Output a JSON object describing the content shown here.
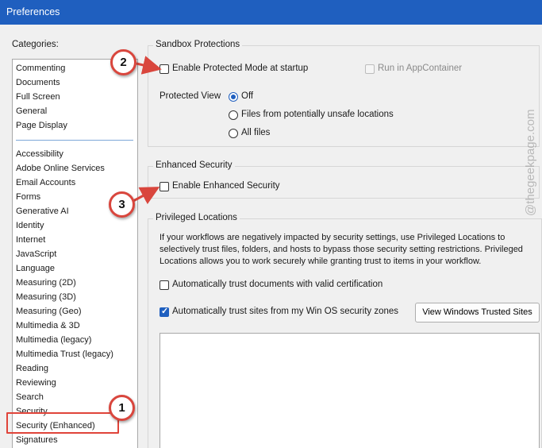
{
  "window": {
    "title": "Preferences"
  },
  "categories": {
    "label": "Categories:",
    "group1": [
      "Commenting",
      "Documents",
      "Full Screen",
      "General",
      "Page Display"
    ],
    "group2": [
      "Accessibility",
      "Adobe Online Services",
      "Email Accounts",
      "Forms",
      "Generative AI",
      "Identity",
      "Internet",
      "JavaScript",
      "Language",
      "Measuring (2D)",
      "Measuring (3D)",
      "Measuring (Geo)",
      "Multimedia & 3D",
      "Multimedia (legacy)",
      "Multimedia Trust (legacy)",
      "Reading",
      "Reviewing",
      "Search",
      "Security",
      "Security (Enhanced)",
      "Signatures"
    ],
    "selected": "Security (Enhanced)"
  },
  "sandbox": {
    "title": "Sandbox Protections",
    "protected_mode_label": "Enable Protected Mode at startup",
    "protected_mode_checked": false,
    "appcontainer_label": "Run in AppContainer",
    "appcontainer_checked": false,
    "protected_view_label": "Protected View",
    "options": [
      "Off",
      "Files from potentially unsafe locations",
      "All files"
    ],
    "selected_option": "Off"
  },
  "enhanced": {
    "title": "Enhanced Security",
    "enable_label": "Enable Enhanced Security",
    "enable_checked": false
  },
  "privileged": {
    "title": "Privileged Locations",
    "description": "If your workflows are negatively impacted by security settings, use Privileged Locations to selectively trust files, folders, and hosts to bypass those security setting restrictions. Privileged Locations allows you to work securely while granting trust to items in your workflow.",
    "trust_cert_label": "Automatically trust documents with valid certification",
    "trust_cert_checked": false,
    "trust_sites_label": "Automatically trust sites from my Win OS security zones",
    "trust_sites_checked": true,
    "view_sites_button": "View Windows Trusted Sites"
  },
  "annotations": {
    "callout1": "1",
    "callout2": "2",
    "callout3": "3",
    "watermark": "@thegeekpage.com",
    "accent_color": "#d9463d"
  },
  "colors": {
    "titlebar": "#1f5fbf",
    "accent": "#1f5fbf"
  }
}
